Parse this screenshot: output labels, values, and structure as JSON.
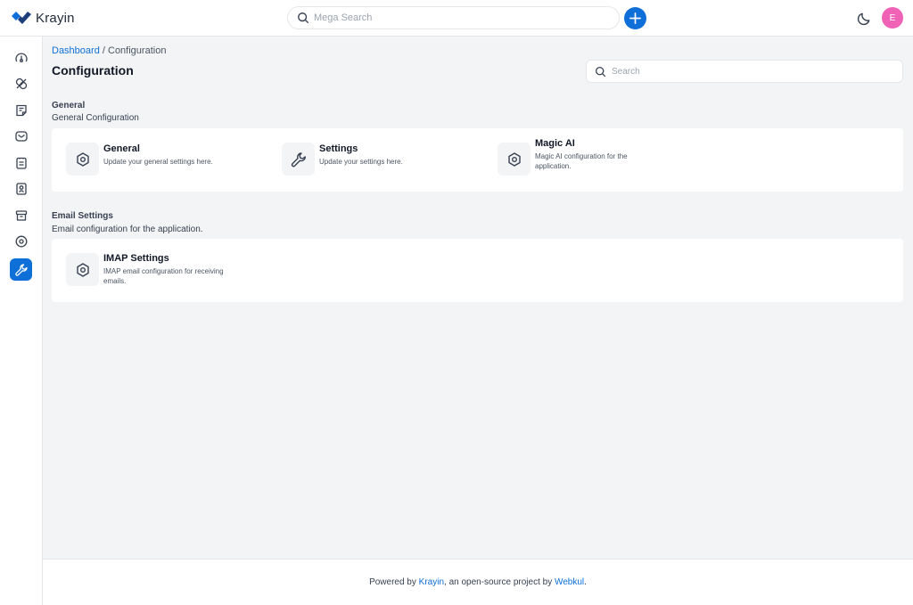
{
  "app": {
    "brand": "Krayin"
  },
  "header": {
    "mega_search_placeholder": "Mega Search",
    "avatar_initial": "E",
    "accent_color": "#0e6fd8",
    "avatar_color": "#f062b6"
  },
  "sidebar": {
    "items": [
      {
        "name": "dashboard",
        "icon": "gauge-icon",
        "active": false
      },
      {
        "name": "leads",
        "icon": "leads-icon",
        "active": false
      },
      {
        "name": "quotes",
        "icon": "quote-icon",
        "active": false
      },
      {
        "name": "mail",
        "icon": "mail-icon",
        "active": false
      },
      {
        "name": "activities",
        "icon": "activity-icon",
        "active": false
      },
      {
        "name": "contacts",
        "icon": "contact-icon",
        "active": false
      },
      {
        "name": "products",
        "icon": "product-icon",
        "active": false
      },
      {
        "name": "settings",
        "icon": "settings-icon",
        "active": false
      },
      {
        "name": "configuration",
        "icon": "wrench-icon",
        "active": true
      }
    ]
  },
  "breadcrumb": {
    "home": "Dashboard",
    "separator": " / ",
    "current": "Configuration"
  },
  "page": {
    "title": "Configuration",
    "search_placeholder": "Search"
  },
  "sections": [
    {
      "title": "General",
      "subtitle": "General Configuration",
      "cards": [
        {
          "title": "General",
          "description": "Update your general settings here.",
          "icon": "settings-icon"
        },
        {
          "title": "Settings",
          "description": "Update your settings here.",
          "icon": "wrench-icon"
        },
        {
          "title": "Magic AI",
          "description": "Magic AI configuration for the application.",
          "icon": "settings-icon"
        }
      ]
    },
    {
      "title": "Email Settings",
      "subtitle": "Email configuration for the application.",
      "cards": [
        {
          "title": "IMAP Settings",
          "description": "IMAP email configuration for receiving emails.",
          "icon": "settings-icon"
        }
      ]
    }
  ],
  "footer": {
    "prefix": "Powered by ",
    "brand_link": "Krayin",
    "middle": ", an open-source project by ",
    "company_link": "Webkul",
    "suffix": "."
  }
}
